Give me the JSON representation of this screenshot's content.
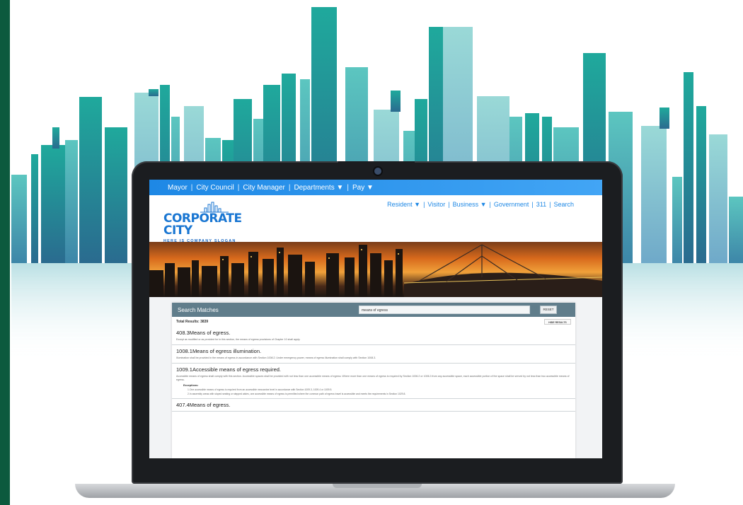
{
  "colors": {
    "accent_blue": "#1e88e5",
    "left_bar": "#0c5a3e",
    "panel_header": "#607d8b",
    "skyline_teal": "#26a69a"
  },
  "topnav": {
    "items": [
      "Mayor",
      "City Council",
      "City Manager",
      "Departments ▼",
      "Pay ▼"
    ],
    "separator": "|"
  },
  "logo": {
    "title": "CORPORATE CITY",
    "slogan": "HERE IS COMPANY SLOGAN"
  },
  "mainnav": {
    "items": [
      "Resident ▼",
      "Visitor",
      "Business ▼",
      "Government",
      "311",
      "Search"
    ],
    "separator": "|"
  },
  "search": {
    "heading": "Search Matches",
    "query": "means of egress",
    "search_icon": "search-icon",
    "reset_label": "RESET",
    "total_label": "Total Results: 3839",
    "hide_button_label": "HIDE RESULTS"
  },
  "results": [
    {
      "title": "408.3Means of egress.",
      "body": "Except as modified or as provided for in this section, the means of egress provisions of Chapter 10 shall apply."
    },
    {
      "title": "1008.1Means of egress illumination.",
      "body": "Illumination shall be provided in the means of egress in accordance with Section 1008.2. Under emergency power, means of egress illumination shall comply with Section 1008.3."
    },
    {
      "title": "1009.1Accessible means of egress required.",
      "body": "Accessible means of egress shall comply with this section. Accessible spaces shall be provided with not less than one accessible means of egress. Where more than one means of egress is required by Section 1006.2 or 1006.3 from any accessible space, each accessible portion of the space shall be served by not less than two accessible means of egress.",
      "exceptions_label": "Exceptions:",
      "exceptions": [
        "1.One accessible means of egress is required from an accessible mezzanine level in accordance with Section 1009.3, 1009.4 or 1009.5.",
        "2.In assembly areas with sloped seating or stepped aisles, one accessible means of egress is permitted where the common path of egress travel is accessible and meets the requirements in Section 1029.8."
      ]
    },
    {
      "title": "407.4Means of egress.",
      "body": ""
    }
  ]
}
